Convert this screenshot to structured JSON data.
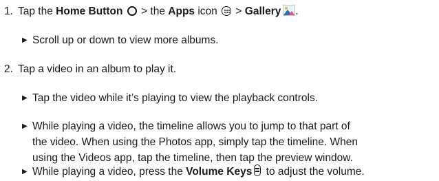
{
  "steps": [
    {
      "number": "1.",
      "prefix": "Tap the ",
      "home_button": "Home Button",
      "sep1": " > the ",
      "apps": "Apps",
      "icon_text": " icon ",
      "sep2": " > ",
      "gallery": "Gallery",
      "end": ".",
      "bullets": [
        {
          "text": "Scroll up or down to view more albums."
        }
      ]
    },
    {
      "number": "2.",
      "text": "Tap a video in an album to play it.",
      "bullets": [
        {
          "text": "Tap the video while it’s playing to view the playback controls."
        },
        {
          "lines": [
            "While playing a video, the timeline allows you to jump to that part of",
            "the video. When using the Photos app, simply tap the timeline. When",
            "using the Videos app, tap the timeline, then tap the preview window."
          ]
        },
        {
          "prefix": "While playing a video, press the ",
          "bold": "Volume Keys",
          "suffix": " to adjust the volume."
        }
      ]
    }
  ],
  "icons": {
    "home": "home-button-icon",
    "apps": "apps-icon",
    "gallery": "gallery-icon",
    "volume": "volume-keys-icon"
  }
}
